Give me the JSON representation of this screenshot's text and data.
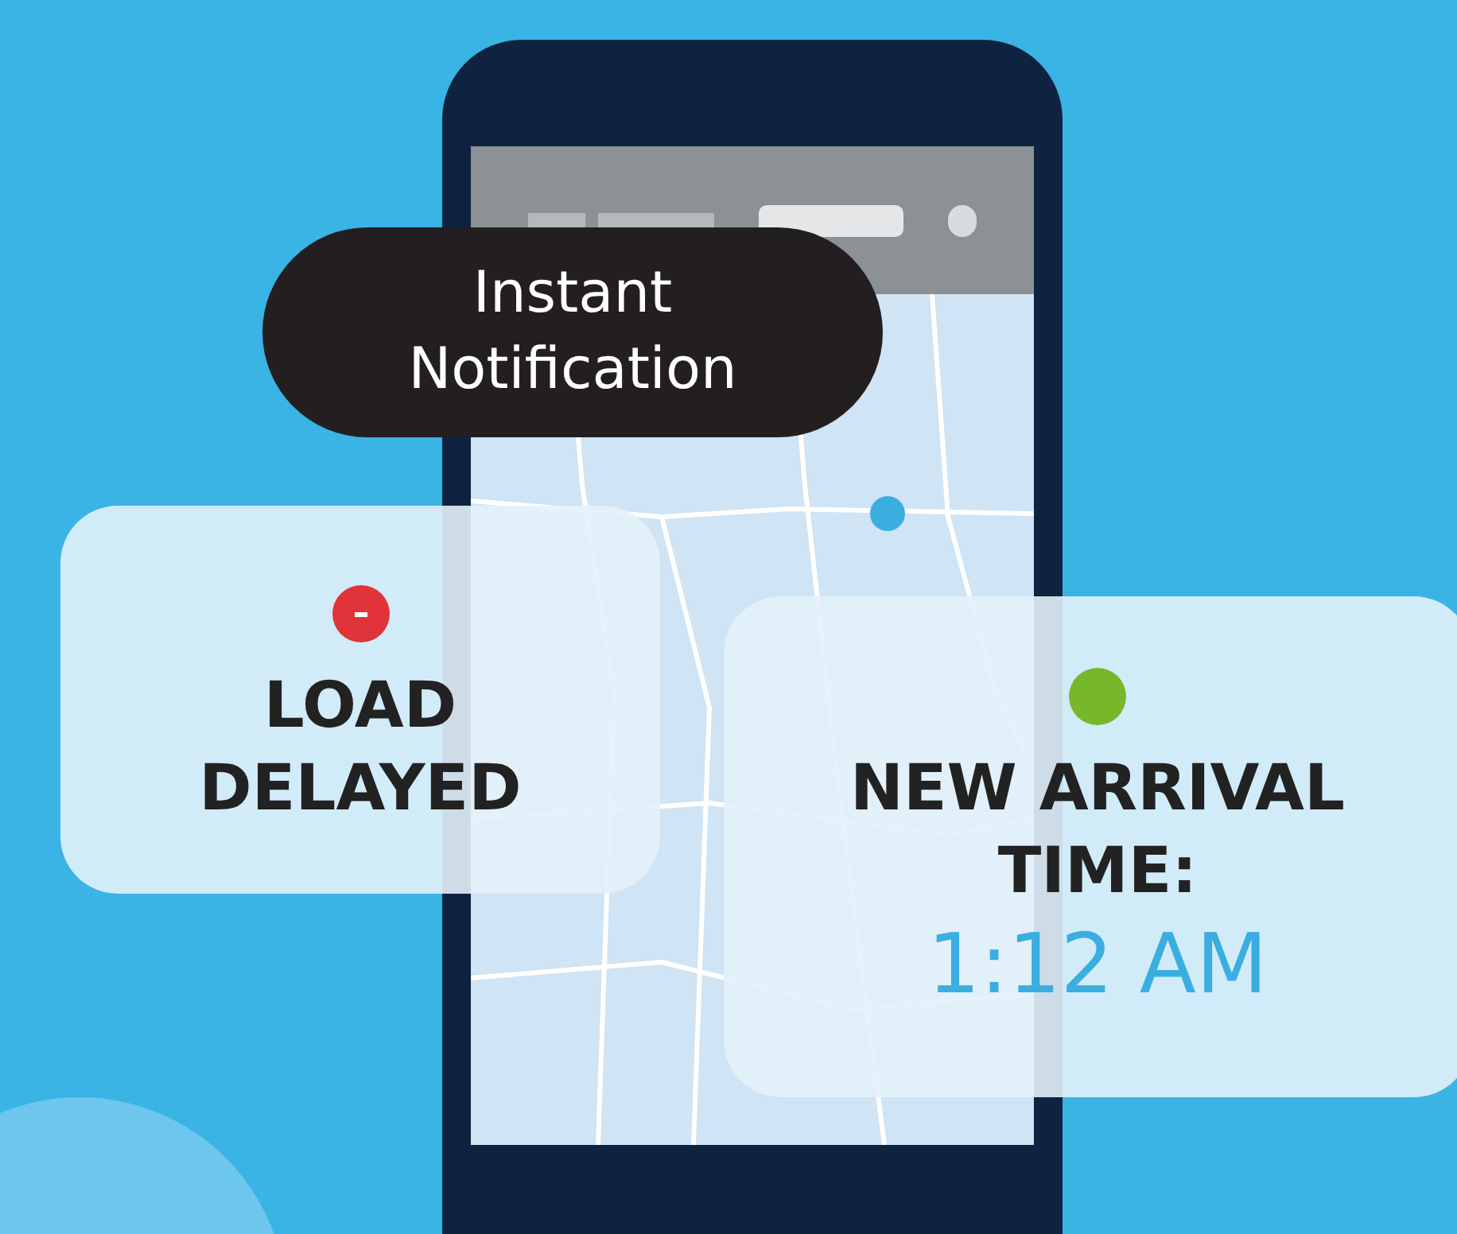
{
  "notification": {
    "lines": [
      "Instant",
      "Notification"
    ]
  },
  "alerts": [
    {
      "kind": "delay",
      "color": "#e0343a",
      "lines": [
        "LOAD",
        "DELAYED"
      ]
    },
    {
      "kind": "arrival",
      "color": "#76b82a",
      "lines": [
        "NEW ARRIVAL",
        "TIME:"
      ],
      "time": "1:12 AM"
    }
  ]
}
